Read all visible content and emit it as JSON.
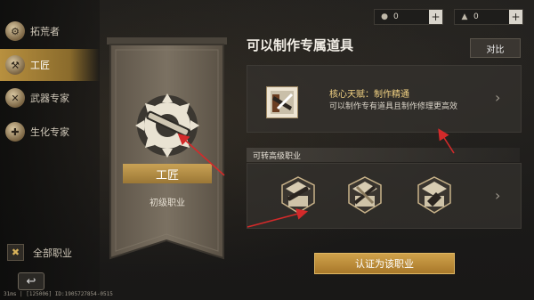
{
  "sidebar": {
    "items": [
      {
        "label": "拓荒者",
        "icon": "pioneer-icon"
      },
      {
        "label": "工匠",
        "icon": "craftsman-icon",
        "active": true
      },
      {
        "label": "武器专家",
        "icon": "weapon-expert-icon"
      },
      {
        "label": "生化专家",
        "icon": "biochem-expert-icon"
      }
    ],
    "all_jobs_label": "全部职业"
  },
  "status_bar": "31ms | [125006] ID:1905727854-0515",
  "resources": [
    {
      "icon": "coin-icon",
      "value": "0"
    },
    {
      "icon": "material-icon",
      "value": "0"
    }
  ],
  "profession": {
    "name": "工匠",
    "tier": "初级职业"
  },
  "main": {
    "title": "可以制作专属道具",
    "compare_label": "对比",
    "talent": {
      "name": "核心天赋：制作精通",
      "description": "可以制作专有道具且制作修理更高效"
    },
    "advanced_header": "可转高级职业",
    "certify_label": "认证为该职业"
  },
  "colors": {
    "accent_gold": "#c9a255",
    "annotation_red": "#d32a2a",
    "panel_bg": "#34312d"
  }
}
